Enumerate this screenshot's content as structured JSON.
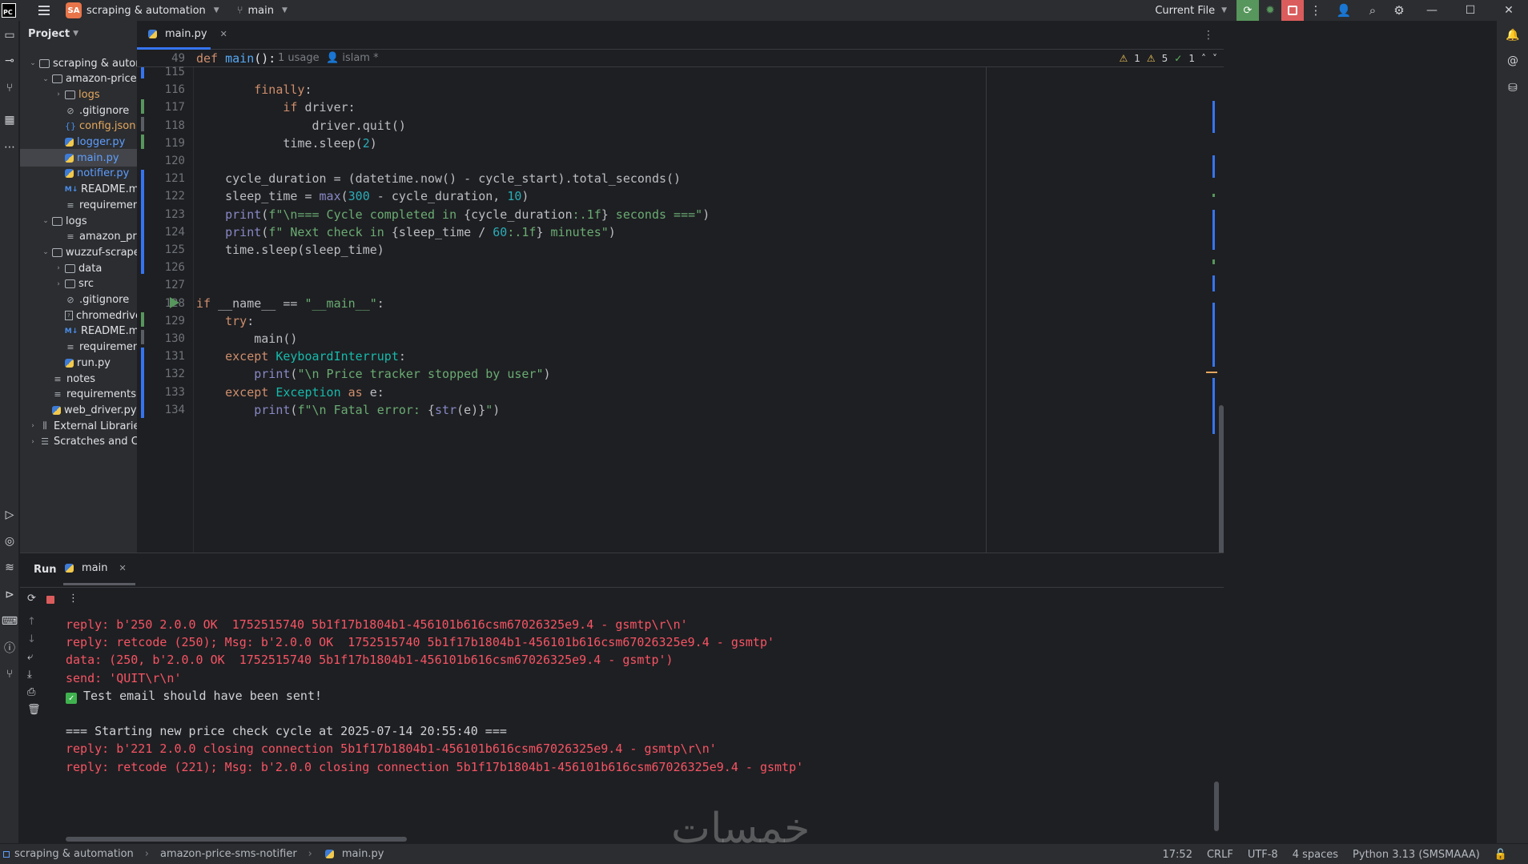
{
  "titlebar": {
    "logo": "PC",
    "project_badge": "SA",
    "project_name": "scraping & automation",
    "branch": "main",
    "run_config": "Current File"
  },
  "project_panel": {
    "title": "Project",
    "tree": [
      {
        "label": "scraping & automati",
        "type": "folder",
        "depth": 0,
        "expanded": true
      },
      {
        "label": "amazon-price-sm",
        "type": "folder",
        "depth": 1,
        "expanded": true
      },
      {
        "label": "logs",
        "type": "folder",
        "depth": 2,
        "expanded": false,
        "color": "orange"
      },
      {
        "label": ".gitignore",
        "type": "ignore",
        "depth": 2
      },
      {
        "label": "config.json",
        "type": "json",
        "depth": 2,
        "color": "orange"
      },
      {
        "label": "logger.py",
        "type": "py",
        "depth": 2,
        "color": "blue"
      },
      {
        "label": "main.py",
        "type": "py",
        "depth": 2,
        "color": "blue",
        "selected": true
      },
      {
        "label": "notifier.py",
        "type": "py",
        "depth": 2,
        "color": "blue"
      },
      {
        "label": "README.md",
        "type": "md",
        "depth": 2
      },
      {
        "label": "requirements.",
        "type": "text",
        "depth": 2
      },
      {
        "label": "logs",
        "type": "folder",
        "depth": 1,
        "expanded": true
      },
      {
        "label": "amazon_price",
        "type": "text",
        "depth": 2
      },
      {
        "label": "wuzzuf-scraper-",
        "type": "folder",
        "depth": 1,
        "expanded": true
      },
      {
        "label": "data",
        "type": "folder",
        "depth": 2,
        "expanded": false
      },
      {
        "label": "src",
        "type": "folder",
        "depth": 2,
        "expanded": false
      },
      {
        "label": ".gitignore",
        "type": "ignore",
        "depth": 2
      },
      {
        "label": "chromedriver.",
        "type": "file",
        "depth": 2
      },
      {
        "label": "README.md",
        "type": "md",
        "depth": 2
      },
      {
        "label": "requirements.",
        "type": "text",
        "depth": 2
      },
      {
        "label": "run.py",
        "type": "py",
        "depth": 2
      },
      {
        "label": "notes",
        "type": "text",
        "depth": 1
      },
      {
        "label": "requirements.txt",
        "type": "text",
        "depth": 1
      },
      {
        "label": "web_driver.py",
        "type": "py",
        "depth": 1
      },
      {
        "label": "External Libraries",
        "type": "lib",
        "depth": 0,
        "expanded": false
      },
      {
        "label": "Scratches and Cons",
        "type": "scratch",
        "depth": 0,
        "expanded": false
      }
    ]
  },
  "editor": {
    "tab_label": "main.py",
    "sticky": {
      "line": "49",
      "code": "def main():",
      "usages": "1 usage",
      "author": "islam *"
    },
    "inspections": {
      "warnings_a": "1",
      "warnings_b": "5",
      "ok": "1"
    },
    "lines": [
      {
        "n": "115",
        "html": ""
      },
      {
        "n": "116",
        "html": "        <span class='kw'>finally</span>:"
      },
      {
        "n": "117",
        "html": "            <span class='kw'>if</span> driver:"
      },
      {
        "n": "118",
        "html": "                driver.quit()"
      },
      {
        "n": "119",
        "html": "            time.sleep(<span class='num'>2</span>)"
      },
      {
        "n": "120",
        "html": ""
      },
      {
        "n": "121",
        "html": "    cycle_duration = (datetime.now() - cycle_start).total_seconds()"
      },
      {
        "n": "122",
        "html": "    sleep_time = <span class='bi'>max</span>(<span class='num'>300</span> - cycle_duration, <span class='num'>10</span>)"
      },
      {
        "n": "123",
        "html": "    <span class='bi'>print</span>(<span class='str'>f\"\\n=== Cycle completed in </span>{cycle_duration<span class='str'>:.1f</span>}<span class='str'> seconds ===\"</span>)"
      },
      {
        "n": "124",
        "html": "    <span class='bi'>print</span>(<span class='str'>f\" Next check in </span>{sleep_time / <span class='num'>60</span><span class='str'>:.1f</span>}<span class='str'> minutes\"</span>)"
      },
      {
        "n": "125",
        "html": "    time.sleep(sleep_time)"
      },
      {
        "n": "126",
        "html": ""
      },
      {
        "n": "127",
        "html": ""
      },
      {
        "n": "128",
        "html": "<span class='kw'>if</span> __name__ == <span class='str'>\"__main__\"</span>:"
      },
      {
        "n": "129",
        "html": "    <span class='kw'>try</span>:"
      },
      {
        "n": "130",
        "html": "        main()"
      },
      {
        "n": "131",
        "html": "    <span class='kw'>except</span> <span class='cls'>KeyboardInterrupt</span>:"
      },
      {
        "n": "132",
        "html": "        <span class='bi'>print</span>(<span class='str'>\"\\n Price tracker stopped by user\"</span>)"
      },
      {
        "n": "133",
        "html": "    <span class='kw'>except</span> <span class='cls'>Exception</span> <span class='kw'>as</span> e:"
      },
      {
        "n": "134",
        "html": "        <span class='bi'>print</span>(<span class='str'>f\"\\n Fatal error: </span>{<span class='bi'>str</span>(e)}<span class='str'>\"</span>)"
      }
    ]
  },
  "run_panel": {
    "title": "Run",
    "tab_label": "main",
    "console": [
      {
        "text": "reply: b'250 2.0.0 OK  1752515740 5b1f17b1804b1-456101b616csm67026325e9.4 - gsmtp\\r\\n'",
        "err": true
      },
      {
        "text": "reply: retcode (250); Msg: b'2.0.0 OK  1752515740 5b1f17b1804b1-456101b616csm67026325e9.4 - gsmtp'",
        "err": true
      },
      {
        "text": "data: (250, b'2.0.0 OK  1752515740 5b1f17b1804b1-456101b616csm67026325e9.4 - gsmtp')",
        "err": true
      },
      {
        "text": "send: 'QUIT\\r\\n'",
        "err": true
      },
      {
        "text": "Test email should have been sent!",
        "err": false,
        "check": true
      },
      {
        "text": "",
        "err": false
      },
      {
        "text": "=== Starting new price check cycle at 2025-07-14 20:55:40 ===",
        "err": false
      },
      {
        "text": "reply: b'221 2.0.0 closing connection 5b1f17b1804b1-456101b616csm67026325e9.4 - gsmtp\\r\\n'",
        "err": true
      },
      {
        "text": "reply: retcode (221); Msg: b'2.0.0 closing connection 5b1f17b1804b1-456101b616csm67026325e9.4 - gsmtp'",
        "err": true
      }
    ]
  },
  "statusbar": {
    "crumbs": [
      "scraping & automation",
      "amazon-price-sms-notifier",
      "main.py"
    ],
    "position": "17:52",
    "line_sep": "CRLF",
    "encoding": "UTF-8",
    "indent": "4 spaces",
    "interpreter": "Python 3.13 (SMSMAAA)"
  },
  "watermark": "خمسات"
}
